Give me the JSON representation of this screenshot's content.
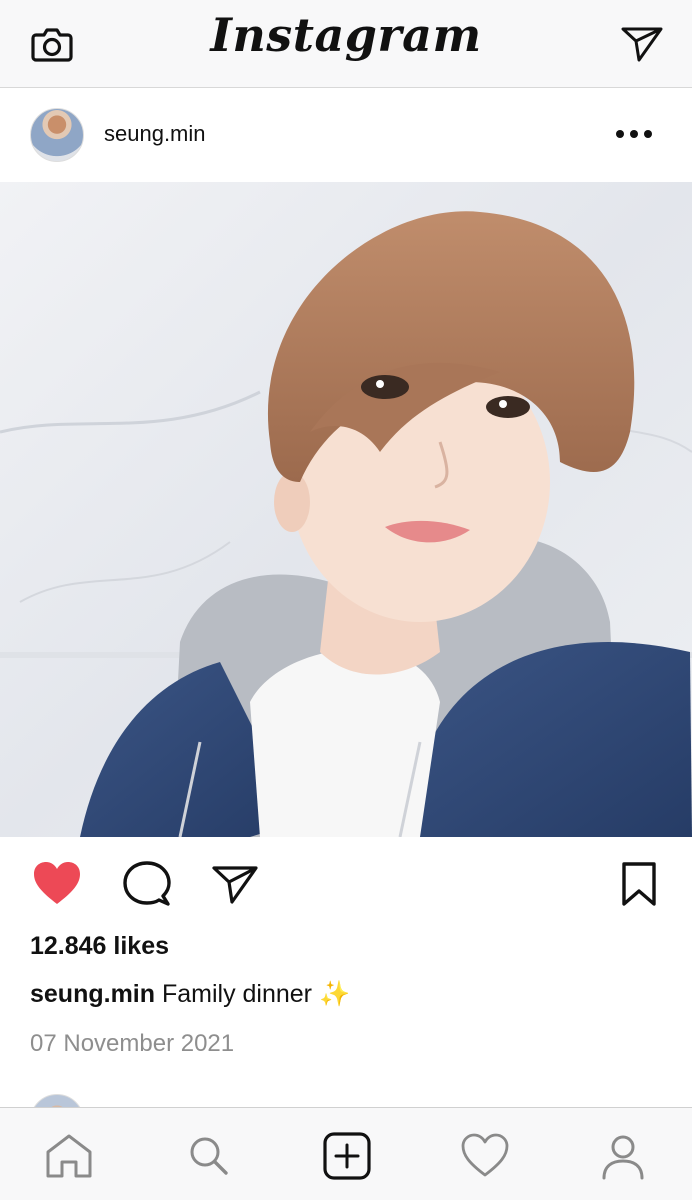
{
  "header": {
    "title": "Instagram"
  },
  "post": {
    "username": "seung.min",
    "likes": "12.846 likes",
    "caption_user": "seung.min",
    "caption_text": " Family dinner ✨",
    "date": "07 November 2021",
    "liked": true
  },
  "icons": {
    "top_left": "camera-icon",
    "top_right": "send-icon",
    "post_menu": "more-icon",
    "actions": [
      "heart-icon",
      "comment-icon",
      "share-icon",
      "bookmark-icon"
    ],
    "tabs": [
      "home-icon",
      "search-icon",
      "add-icon",
      "heart-icon",
      "profile-icon"
    ]
  },
  "colors": {
    "like_red": "#ed4956",
    "text": "#111111",
    "muted": "#8e8e8e",
    "bar_bg": "#f8f8f9"
  }
}
